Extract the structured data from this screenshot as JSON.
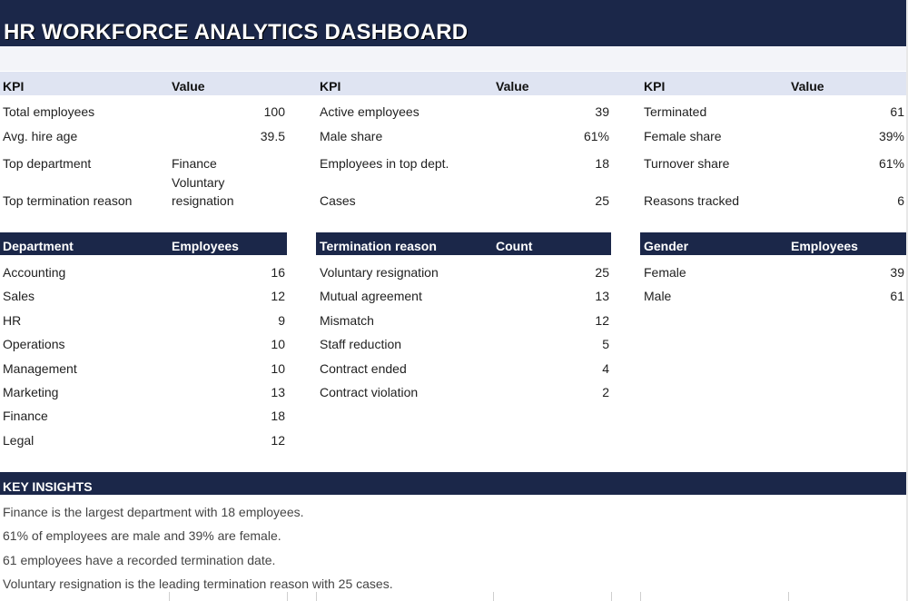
{
  "title": "HR WORKFORCE ANALYTICS DASHBOARD",
  "kpi_header": {
    "kpi": "KPI",
    "value": "Value"
  },
  "kpi_col1": [
    {
      "label": "Total employees",
      "value": "100"
    },
    {
      "label": "Avg. hire age",
      "value": "39.5"
    },
    {
      "label": "Top department",
      "value": "Finance"
    },
    {
      "label": "Top termination reason",
      "value_line1": "Voluntary",
      "value_line2": "resignation"
    }
  ],
  "kpi_col2": [
    {
      "label": "Active employees",
      "value": "39"
    },
    {
      "label": "Male share",
      "value": "61%"
    },
    {
      "label": "Employees in top dept.",
      "value": "18"
    },
    {
      "label": "Cases",
      "value": "25"
    }
  ],
  "kpi_col3": [
    {
      "label": "Terminated",
      "value": "61"
    },
    {
      "label": "Female share",
      "value": "39%"
    },
    {
      "label": "Turnover share",
      "value": "61%"
    },
    {
      "label": "Reasons tracked",
      "value": "6"
    }
  ],
  "departments": {
    "headers": [
      "Department",
      "Employees"
    ],
    "rows": [
      {
        "name": "Accounting",
        "value": "16"
      },
      {
        "name": "Sales",
        "value": "12"
      },
      {
        "name": "HR",
        "value": "9"
      },
      {
        "name": "Operations",
        "value": "10"
      },
      {
        "name": "Management",
        "value": "10"
      },
      {
        "name": "Marketing",
        "value": "13"
      },
      {
        "name": "Finance",
        "value": "18"
      },
      {
        "name": "Legal",
        "value": "12"
      }
    ]
  },
  "termination": {
    "headers": [
      "Termination reason",
      "Count"
    ],
    "rows": [
      {
        "name": "Voluntary resignation",
        "value": "25"
      },
      {
        "name": "Mutual agreement",
        "value": "13"
      },
      {
        "name": "Mismatch",
        "value": "12"
      },
      {
        "name": "Staff reduction",
        "value": "5"
      },
      {
        "name": "Contract ended",
        "value": "4"
      },
      {
        "name": "Contract violation",
        "value": "2"
      }
    ]
  },
  "gender": {
    "headers": [
      "Gender",
      "Employees"
    ],
    "rows": [
      {
        "name": "Female",
        "value": "39"
      },
      {
        "name": "Male",
        "value": "61"
      }
    ]
  },
  "insights": {
    "title": "KEY INSIGHTS",
    "lines": [
      "Finance is the largest department with 18 employees.",
      "61% of employees are male and 39% are female.",
      "61 employees have a recorded termination date.",
      "Voluntary resignation is the leading termination reason with 25 cases."
    ]
  }
}
